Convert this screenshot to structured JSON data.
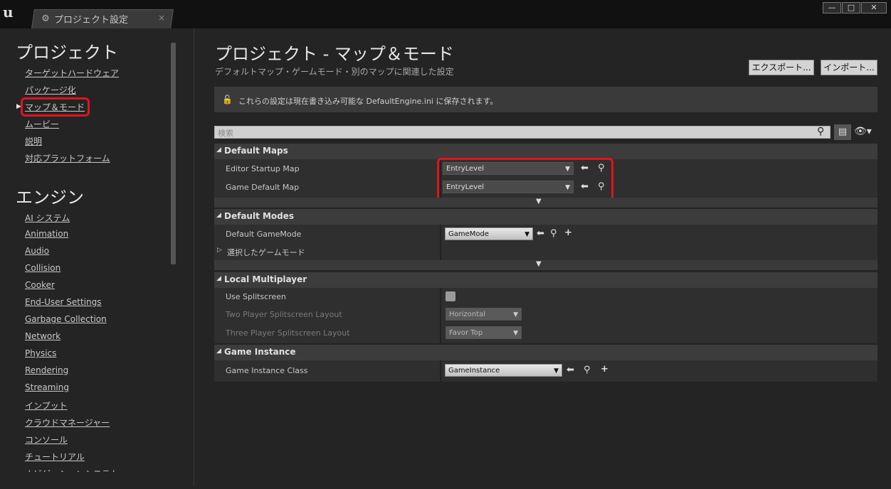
{
  "window": {
    "tab_label": "プロジェクト設定",
    "tab_close": "×",
    "minimize": "—",
    "maximize": "□",
    "close": "✕"
  },
  "sidebar": {
    "project_heading": "プロジェクト",
    "project_items": [
      {
        "label": "ターゲットハードウェア"
      },
      {
        "label": "パッケージ化"
      },
      {
        "label": "マップ＆モード"
      },
      {
        "label": "ムービー"
      },
      {
        "label": "説明"
      },
      {
        "label": "対応プラットフォーム"
      }
    ],
    "engine_heading": "エンジン",
    "engine_items": [
      {
        "label": "AI システム"
      },
      {
        "label": "Animation"
      },
      {
        "label": "Audio"
      },
      {
        "label": "Collision"
      },
      {
        "label": "Cooker"
      },
      {
        "label": "End-User Settings"
      },
      {
        "label": "Garbage Collection"
      },
      {
        "label": "Network"
      },
      {
        "label": "Physics"
      },
      {
        "label": "Rendering"
      },
      {
        "label": "Streaming"
      },
      {
        "label": "インプット"
      },
      {
        "label": "クラウドマネージャー"
      },
      {
        "label": "コンソール"
      },
      {
        "label": "チュートリアル"
      },
      {
        "label": "ナビゲーションシステム"
      }
    ]
  },
  "main": {
    "title": "プロジェクト - マップ＆モード",
    "subtitle": "デフォルトマップ・ゲームモード・別のマップに関連した設定",
    "export_label": "エクスポート...",
    "import_label": "インポート...",
    "notice": "これらの設定は現在書き込み可能な DefaultEngine.ini に保存されます。",
    "search_placeholder": "検索"
  },
  "sections": {
    "default_maps": {
      "title": "Default Maps",
      "editor_startup_label": "Editor Startup Map",
      "editor_startup_value": "EntryLevel",
      "game_default_label": "Game Default Map",
      "game_default_value": "EntryLevel"
    },
    "default_modes": {
      "title": "Default Modes",
      "gamemode_label": "Default GameMode",
      "gamemode_value": "GameMode",
      "selected_label": "選択したゲームモード"
    },
    "local_multiplayer": {
      "title": "Local Multiplayer",
      "splitscreen_label": "Use Splitscreen",
      "two_player_label": "Two Player Splitscreen Layout",
      "two_player_value": "Horizontal",
      "three_player_label": "Three Player Splitscreen Layout",
      "three_player_value": "Favor Top"
    },
    "game_instance": {
      "title": "Game Instance",
      "class_label": "Game Instance Class",
      "class_value": "GameInstance"
    }
  },
  "colors": {
    "highlight_box": "#e0141e",
    "background": "#242424"
  }
}
